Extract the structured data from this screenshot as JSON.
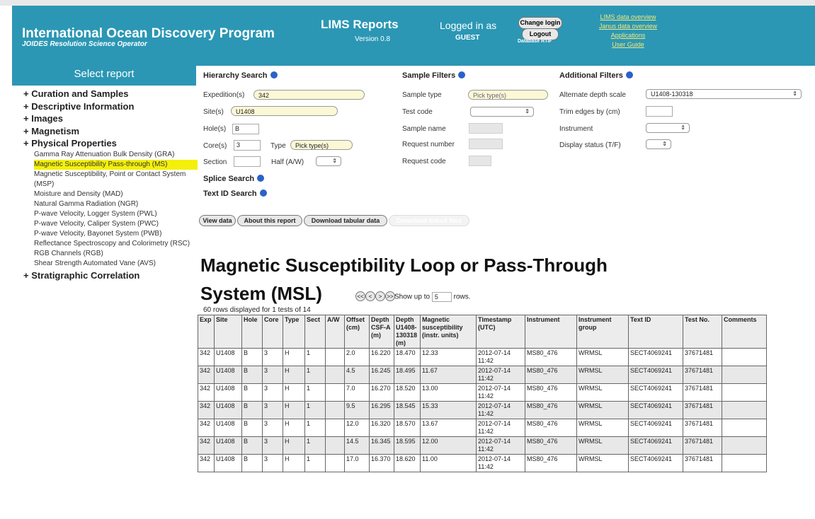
{
  "header": {
    "org_title": "International Ocean Discovery Program",
    "org_subtitle": "JOIDES Resolution Science Operator",
    "app_title": "LIMS Reports",
    "version": "Version 0.8",
    "logged_in_label": "Logged in as",
    "user": "GUEST",
    "change_login": "Change login",
    "logout": "Logout",
    "database": "Database RTIF",
    "links": [
      "LIMS data overview",
      "Janus data overview",
      "Applications",
      "User Guide"
    ]
  },
  "sidebar": {
    "title": "Select report",
    "categories": [
      {
        "label": "+ Curation and Samples"
      },
      {
        "label": "+ Descriptive Information"
      },
      {
        "label": "+ Images"
      },
      {
        "label": "+ Magnetism"
      },
      {
        "label": "+ Physical Properties"
      }
    ],
    "physical_properties_items": [
      "Gamma Ray Attenuation Bulk Density (GRA)",
      "Magnetic Susceptibility Pass-through (MS)",
      "Magnetic Susceptibility, Point or Contact System (MSP)",
      "Moisture and Density (MAD)",
      "Natural Gamma Radiation (NGR)",
      "P-wave Velocity, Logger System (PWL)",
      "P-wave Velocity, Caliper System (PWC)",
      "P-wave Velocity, Bayonet System (PWB)",
      "Reflectance Spectroscopy and Colorimetry (RSC)",
      "RGB Channels (RGB)",
      "Shear Strength Automated Vane (AVS)"
    ],
    "last_category": "+ Stratigraphic Correlation"
  },
  "hierarchy": {
    "title": "Hierarchy Search",
    "expedition_label": "Expedition(s)",
    "expedition_value": "342",
    "site_label": "Site(s)",
    "site_value": "U1408",
    "hole_label": "Hole(s)",
    "hole_value": "B",
    "core_label": "Core(s)",
    "core_value": "3",
    "type_label": "Type",
    "type_value": "Pick type(s)",
    "section_label": "Section",
    "half_label": "Half (A/W)",
    "splice": "Splice Search",
    "textid": "Text ID Search"
  },
  "sample_filters": {
    "title": "Sample Filters",
    "sample_type_label": "Sample type",
    "sample_type_value": "Pick type(s)",
    "test_code_label": "Test code",
    "sample_name_label": "Sample name",
    "request_number_label": "Request number",
    "request_code_label": "Request code"
  },
  "additional_filters": {
    "title": "Additional Filters",
    "alt_depth_label": "Alternate depth scale",
    "alt_depth_value": "U1408-130318",
    "trim_label": "Trim edges by (cm)",
    "instrument_label": "Instrument",
    "display_status_label": "Display status (T/F)"
  },
  "actions": {
    "view": "View data",
    "about": "About this report",
    "download": "Download tabular data",
    "download_linked": "Download linked files"
  },
  "report": {
    "title_line1": "Magnetic Susceptibility Loop or Pass-Through",
    "title_line2": "System (MSL)",
    "nav": [
      "<<",
      "<",
      ">",
      ">>"
    ],
    "show_up_to": "Show up to",
    "rows_value": "5",
    "rows_label": "rows.",
    "rows_displayed": "60 rows displayed for 1 tests of 14"
  },
  "table": {
    "columns": [
      "Exp",
      "Site",
      "Hole",
      "Core",
      "Type",
      "Sect",
      "A/W",
      "Offset (cm)",
      "Depth CSF-A (m)",
      "Depth U1408-130318 (m)",
      "Magnetic susceptibility (instr. units)",
      "Timestamp (UTC)",
      "Instrument",
      "Instrument group",
      "Text ID",
      "Test No.",
      "Comments"
    ],
    "rows": [
      [
        "342",
        "U1408",
        "B",
        "3",
        "H",
        "1",
        "",
        "2.0",
        "16.220",
        "18.470",
        "12.33",
        "2012-07-14 11:42",
        "MS80_476",
        "WRMSL",
        "SECT4069241",
        "37671481",
        ""
      ],
      [
        "342",
        "U1408",
        "B",
        "3",
        "H",
        "1",
        "",
        "4.5",
        "16.245",
        "18.495",
        "11.67",
        "2012-07-14 11:42",
        "MS80_476",
        "WRMSL",
        "SECT4069241",
        "37671481",
        ""
      ],
      [
        "342",
        "U1408",
        "B",
        "3",
        "H",
        "1",
        "",
        "7.0",
        "16.270",
        "18.520",
        "13.00",
        "2012-07-14 11:42",
        "MS80_476",
        "WRMSL",
        "SECT4069241",
        "37671481",
        ""
      ],
      [
        "342",
        "U1408",
        "B",
        "3",
        "H",
        "1",
        "",
        "9.5",
        "16.295",
        "18.545",
        "15.33",
        "2012-07-14 11:42",
        "MS80_476",
        "WRMSL",
        "SECT4069241",
        "37671481",
        ""
      ],
      [
        "342",
        "U1408",
        "B",
        "3",
        "H",
        "1",
        "",
        "12.0",
        "16.320",
        "18.570",
        "13.67",
        "2012-07-14 11:42",
        "MS80_476",
        "WRMSL",
        "SECT4069241",
        "37671481",
        ""
      ],
      [
        "342",
        "U1408",
        "B",
        "3",
        "H",
        "1",
        "",
        "14.5",
        "16.345",
        "18.595",
        "12.00",
        "2012-07-14 11:42",
        "MS80_476",
        "WRMSL",
        "SECT4069241",
        "37671481",
        ""
      ],
      [
        "342",
        "U1408",
        "B",
        "3",
        "H",
        "1",
        "",
        "17.0",
        "16.370",
        "18.620",
        "11.00",
        "2012-07-14 11:42",
        "MS80_476",
        "WRMSL",
        "SECT4069241",
        "37671481",
        ""
      ]
    ]
  }
}
